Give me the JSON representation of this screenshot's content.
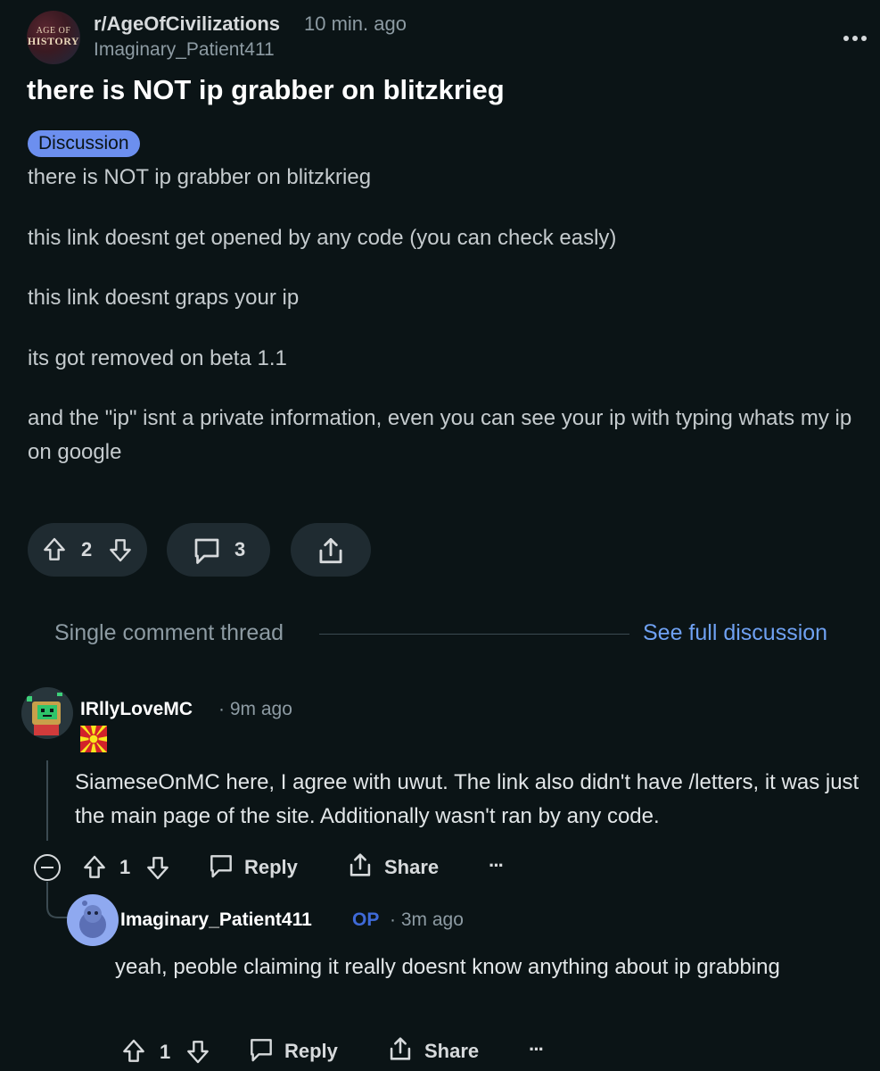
{
  "header": {
    "subreddit": "r/AgeOfCivilizations",
    "time": "10 min. ago",
    "author": "Imaginary_Patient411",
    "more_icon": "more-horizontal-icon",
    "avatar_text_1": "AGE OF",
    "avatar_text_2": "HISTORY"
  },
  "post": {
    "title": "there is NOT ip grabber on blitzkrieg",
    "flair": "Discussion",
    "flair_color": "#6c8fef",
    "paragraphs": [
      "there is NOT ip grabber on blitzkrieg",
      "this link doesnt get opened by any code (you can check easly)",
      "this link doesnt graps your ip",
      "its got removed on beta 1.1",
      "and the \"ip\" isnt a private information, even you can see your ip with typing whats my ip on google"
    ],
    "votes": "2",
    "comments": "3"
  },
  "thread": {
    "label": "Single comment thread",
    "see_full": "See full discussion",
    "link_color": "#6fa1f2"
  },
  "comments": [
    {
      "author": "IRllyLoveMC",
      "time": "· 9m ago",
      "body": "SiameseOnMC here, I agree with uwut. The link also didn't have /letters, it was just the main page of the site. Additionally wasn't ran by any code.",
      "votes": "1",
      "reply_label": "Reply",
      "share_label": "Share",
      "more": "···"
    },
    {
      "author": "Imaginary_Patient411",
      "op_tag": "OP",
      "time": "· 3m ago",
      "body": "yeah, peoble claiming it really doesnt know anything about ip grabbing",
      "votes": "1",
      "reply_label": "Reply",
      "share_label": "Share",
      "more": "···"
    }
  ],
  "colors": {
    "background": "#0b1416",
    "pill": "#1f2b31",
    "op": "#3f6ad8"
  }
}
